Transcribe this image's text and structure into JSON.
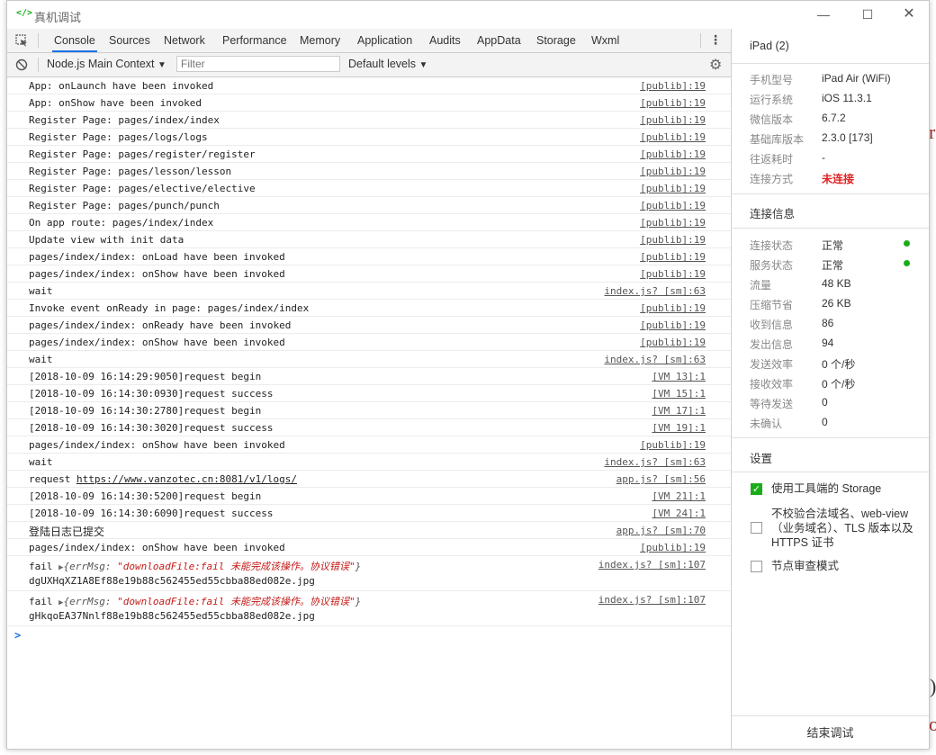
{
  "window": {
    "title": "真机调试",
    "title_icon": "</>"
  },
  "devtools": {
    "tabs": [
      "Console",
      "Sources",
      "Network",
      "Performance",
      "Memory",
      "Application",
      "Audits",
      "AppData",
      "Storage",
      "Wxml"
    ],
    "context": "Node.js Main Context",
    "filter_placeholder": "Filter",
    "levels": "Default levels"
  },
  "console_rows": [
    {
      "msg": "App: onLaunch have been invoked",
      "src": "[publib]:19"
    },
    {
      "msg": "App: onShow have been invoked",
      "src": "[publib]:19"
    },
    {
      "msg": "Register Page: pages/index/index",
      "src": "[publib]:19"
    },
    {
      "msg": "Register Page: pages/logs/logs",
      "src": "[publib]:19"
    },
    {
      "msg": "Register Page: pages/register/register",
      "src": "[publib]:19"
    },
    {
      "msg": "Register Page: pages/lesson/lesson",
      "src": "[publib]:19"
    },
    {
      "msg": "Register Page: pages/elective/elective",
      "src": "[publib]:19"
    },
    {
      "msg": "Register Page: pages/punch/punch",
      "src": "[publib]:19"
    },
    {
      "msg": "On app route: pages/index/index",
      "src": "[publib]:19"
    },
    {
      "msg": "Update view with init data",
      "src": "[publib]:19"
    },
    {
      "msg": "pages/index/index: onLoad have been invoked",
      "src": "[publib]:19"
    },
    {
      "msg": "pages/index/index: onShow have been invoked",
      "src": "[publib]:19"
    },
    {
      "msg": "wait",
      "src": "index.js? [sm]:63"
    },
    {
      "msg": "Invoke event onReady in page: pages/index/index",
      "src": "[publib]:19"
    },
    {
      "msg": "pages/index/index: onReady have been invoked",
      "src": "[publib]:19"
    },
    {
      "msg": "pages/index/index: onShow have been invoked",
      "src": "[publib]:19"
    },
    {
      "msg": "wait",
      "src": "index.js? [sm]:63"
    },
    {
      "msg": "[2018-10-09 16:14:29:9050]request begin",
      "src": "[VM 13]:1"
    },
    {
      "msg": "[2018-10-09 16:14:30:0930]request success",
      "src": "[VM 15]:1"
    },
    {
      "msg": "[2018-10-09 16:14:30:2780]request begin",
      "src": "[VM 17]:1"
    },
    {
      "msg": "[2018-10-09 16:14:30:3020]request success",
      "src": "[VM 19]:1"
    },
    {
      "msg": "pages/index/index: onShow have been invoked",
      "src": "[publib]:19"
    },
    {
      "msg": "wait",
      "src": "index.js? [sm]:63"
    }
  ],
  "request_row": {
    "prefix": "request ",
    "url": "https://www.vanzotec.cn:8081/v1/logs/",
    "src": "app.js? [sm]:56"
  },
  "console_rows2": [
    {
      "msg": "[2018-10-09 16:14:30:5200]request begin",
      "src": "[VM 21]:1"
    },
    {
      "msg": "[2018-10-09 16:14:30:6090]request success",
      "src": "[VM 24]:1"
    }
  ],
  "log_submitted_row": {
    "msg": "登陆日志已提交",
    "src": "app.js? [sm]:70"
  },
  "onshow_row": {
    "msg": "pages/index/index: onShow have been invoked",
    "src": "[publib]:19"
  },
  "fail_rows": [
    {
      "prefix": "fail ",
      "key": "{errMsg: ",
      "value": "\"downloadFile:fail 未能完成该操作。协议错误\"",
      "close": "}",
      "line2": "dgUXHqXZ1A8Ef88e19b88c562455ed55cbba88ed082e.jpg",
      "src": "index.js? [sm]:107"
    },
    {
      "prefix": "fail ",
      "key": "{errMsg: ",
      "value": "\"downloadFile:fail 未能完成该操作。协议错误\"",
      "close": "}",
      "line2": "gHkqoEA37Nnlf88e19b88c562455ed55cbba88ed082e.jpg",
      "src": "index.js? [sm]:107"
    }
  ],
  "prompt": ">",
  "sidebar": {
    "device_title": "iPad (2)",
    "device_info": [
      {
        "k": "手机型号",
        "v": "iPad Air (WiFi)"
      },
      {
        "k": "运行系统",
        "v": "iOS 11.3.1"
      },
      {
        "k": "微信版本",
        "v": "6.7.2"
      },
      {
        "k": "基础库版本",
        "v": "2.3.0 [173]"
      },
      {
        "k": "往返耗时",
        "v": "-"
      },
      {
        "k": "连接方式",
        "v": "未连接"
      }
    ],
    "conn_title": "连接信息",
    "conn_info": [
      {
        "k": "连接状态",
        "v": "正常"
      },
      {
        "k": "服务状态",
        "v": "正常"
      },
      {
        "k": "流量",
        "v": "48 KB"
      },
      {
        "k": "压缩节省",
        "v": "26 KB"
      },
      {
        "k": "收到信息",
        "v": "86"
      },
      {
        "k": "发出信息",
        "v": "94"
      },
      {
        "k": "发送效率",
        "v": "0 个/秒"
      },
      {
        "k": "接收效率",
        "v": "0 个/秒"
      },
      {
        "k": "等待发送",
        "v": "0"
      },
      {
        "k": "未确认",
        "v": "0"
      }
    ],
    "settings_title": "设置",
    "settings": [
      {
        "label": "使用工具端的 Storage",
        "checked": true
      },
      {
        "label": "不校验合法域名、web-view（业务域名）、TLS 版本以及 HTTPS 证书",
        "checked": false
      },
      {
        "label": "节点审查模式",
        "checked": false
      }
    ],
    "end_button": "结束调试"
  },
  "background": {
    "c1": "r",
    "c2": ")",
    "c3": "o"
  },
  "colors": {
    "accent": "#1a73e8",
    "status_ok": "#1aad19",
    "error": "#c41a16",
    "warn_red": "#e02020"
  }
}
